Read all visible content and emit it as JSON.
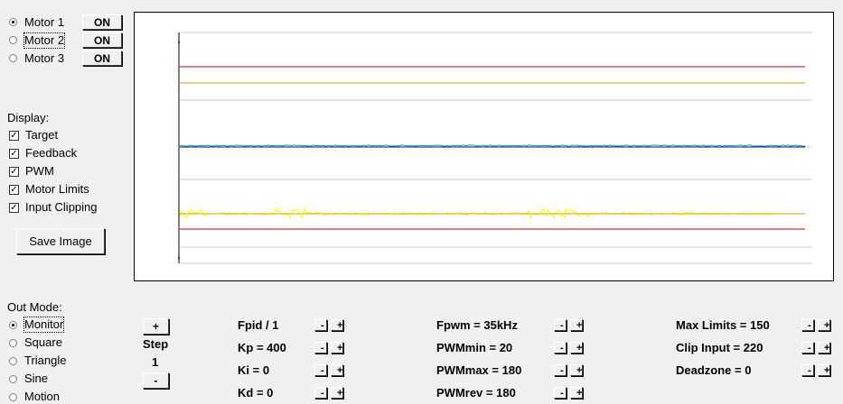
{
  "motors": [
    {
      "label": "Motor 1",
      "selected": true,
      "button": "ON"
    },
    {
      "label": "Motor 2",
      "selected": false,
      "button": "ON"
    },
    {
      "label": "Motor 3",
      "selected": false,
      "button": "ON"
    }
  ],
  "display": {
    "title": "Display:",
    "options": [
      {
        "label": "Target",
        "checked": true
      },
      {
        "label": "Feedback",
        "checked": true
      },
      {
        "label": "PWM",
        "checked": true
      },
      {
        "label": "Motor Limits",
        "checked": true
      },
      {
        "label": "Input Clipping",
        "checked": true
      }
    ],
    "save_label": "Save Image"
  },
  "out_mode": {
    "title": "Out Mode:",
    "options": [
      {
        "label": "Monitor",
        "selected": true
      },
      {
        "label": "Square",
        "selected": false
      },
      {
        "label": "Triangle",
        "selected": false
      },
      {
        "label": "Sine",
        "selected": false
      },
      {
        "label": "Motion",
        "selected": false
      }
    ]
  },
  "step": {
    "plus": "+",
    "label": "Step",
    "value": "1",
    "minus": "-"
  },
  "params": {
    "col1": [
      "Fpid / 1",
      "Kp = 400",
      "Ki = 0",
      "Kd = 0"
    ],
    "col2": [
      "Fpwm = 35kHz",
      "PWMmin = 20",
      "PWMmax = 180",
      "PWMrev = 180"
    ],
    "col3": [
      "Max Limits = 150",
      "Clip Input = 220",
      "Deadzone = 0"
    ],
    "minus": "-",
    "plus": "+"
  },
  "colors": {
    "limit_line": "#c00000",
    "clip_line": "#e0a000",
    "target_line": "#0000a0",
    "feedback_line": "#00b060",
    "pwm_noise": "#ffff00",
    "grid": "#c8c8c8"
  }
}
